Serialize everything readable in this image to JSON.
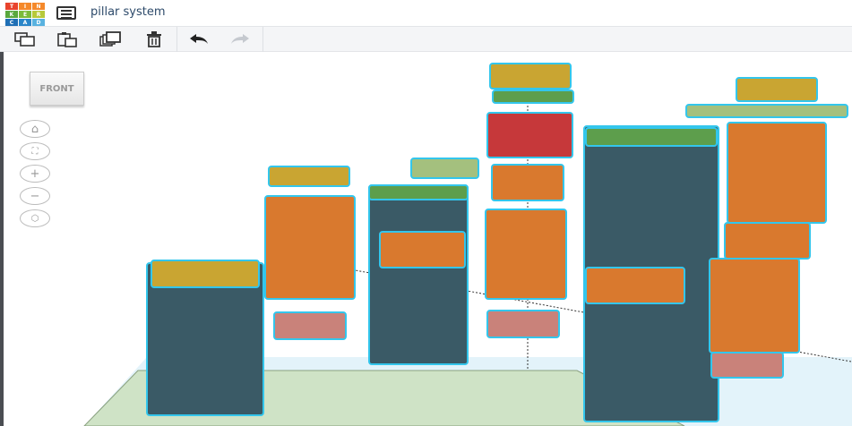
{
  "app": {
    "logo_letters": [
      "T",
      "I",
      "N",
      "K",
      "E",
      "R",
      "C",
      "A",
      "D"
    ],
    "logo_colors": [
      "#e8432c",
      "#f5892a",
      "#f5892a",
      "#5aa83d",
      "#7bbb3a",
      "#b7c93a",
      "#1f6fb5",
      "#2a86c9",
      "#59b2e0"
    ]
  },
  "header": {
    "title": "pillar system"
  },
  "toolbar": {
    "items": [
      "copy",
      "paste",
      "duplicate",
      "delete",
      "undo",
      "redo"
    ]
  },
  "viewcube": {
    "label": "FRONT"
  },
  "nav": {
    "items": [
      "home-view",
      "fit-all",
      "zoom-in",
      "zoom-out",
      "orthographic"
    ]
  },
  "colors": {
    "outline": "#33c6ec",
    "orange": "#d9792e",
    "yellow": "#c9a532",
    "green": "#5d9e4c",
    "red": "#c6383a",
    "pink": "#c9827a",
    "plate": "#cfe3c6",
    "floor": "#e3f3fa"
  }
}
